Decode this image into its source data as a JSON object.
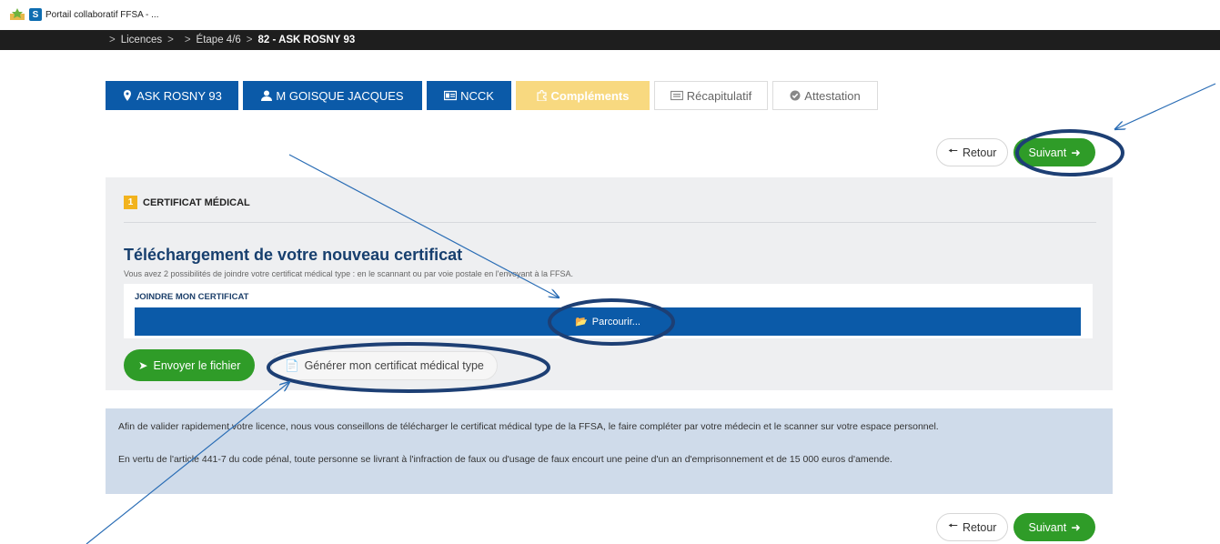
{
  "browser": {
    "tab_title": "Portail collaboratif FFSA - ...",
    "tab_icon_letter": "S"
  },
  "breadcrumb": {
    "sep": ">",
    "item1": "Licences",
    "item2": "",
    "item3": "Étape 4/6",
    "item4": "82 - ASK ROSNY 93"
  },
  "steps": [
    {
      "label": "ASK ROSNY 93",
      "icon": "map-marker-icon"
    },
    {
      "label": "M GOISQUE JACQUES",
      "icon": "user-icon"
    },
    {
      "label": "NCCK",
      "icon": "id-card-icon"
    },
    {
      "label": "Compléments",
      "icon": "puzzle-icon"
    },
    {
      "label": "Récapitulatif",
      "icon": "list-icon"
    },
    {
      "label": "Attestation",
      "icon": "check-circle-icon"
    }
  ],
  "nav": {
    "back_label": "Retour",
    "next_label": "Suivant"
  },
  "certificate": {
    "step_number": "1",
    "section_title": "CERTIFICAT MÉDICAL",
    "title": "Téléchargement de votre nouveau certificat",
    "subtitle": "Vous avez 2 possibilités de joindre votre certificat médical type : en le scannant ou par voie postale en l'envoyant à la FFSA.",
    "attach_label": "JOINDRE MON CERTIFICAT",
    "browse_label": "Parcourir...",
    "send_label": "Envoyer le fichier",
    "generate_label": "Générer mon certificat médical type"
  },
  "info": {
    "paragraph1": "Afin de valider rapidement votre licence, nous vous conseillons de télécharger le certificat médical type de la FFSA, le faire compléter par votre médecin et le scanner sur votre espace personnel.",
    "paragraph2": "En vertu de l'article 441-7 du code pénal, toute personne se livrant à l'infraction de faux ou d'usage de faux encourt une peine d'un an d'emprisonnement et de 15 000 euros d'amende."
  },
  "colors": {
    "primary_blue": "#0b5aa8",
    "success_green": "#2f9c28",
    "warning_yellow": "#f8d980",
    "annotation": "#1d3f74"
  }
}
